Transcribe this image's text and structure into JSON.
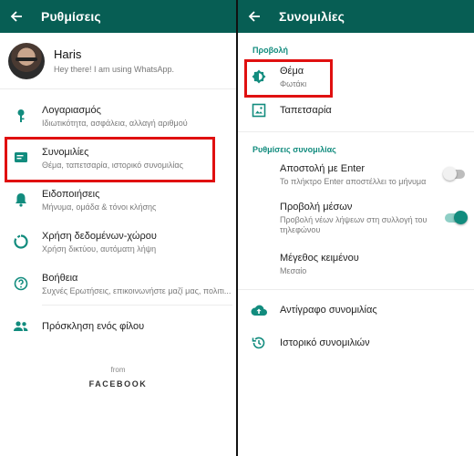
{
  "left": {
    "appbar": {
      "title": "Ρυθμίσεις"
    },
    "profile": {
      "name": "Haris",
      "status": "Hey there! I am using WhatsApp."
    },
    "items": [
      {
        "icon": "key-icon",
        "label": "Λογαριασμός",
        "sub": "Ιδιωτικότητα, ασφάλεια, αλλαγή αριθμού"
      },
      {
        "icon": "chat-icon",
        "label": "Συνομιλίες",
        "sub": "Θέμα, ταπετσαρία, ιστορικό συνομιλίας"
      },
      {
        "icon": "bell-icon",
        "label": "Ειδοποιήσεις",
        "sub": "Μήνυμα, ομάδα & τόνοι κλήσης"
      },
      {
        "icon": "data-usage-icon",
        "label": "Χρήση δεδομένων-χώρου",
        "sub": "Χρήση δικτύου, αυτόματη λήψη"
      },
      {
        "icon": "help-icon",
        "label": "Βοήθεια",
        "sub": "Συχνές Ερωτήσεις, επικοινωνήστε μαζί μας, πολιτι..."
      }
    ],
    "invite": {
      "icon": "people-icon",
      "label": "Πρόσκληση ενός φίλου"
    },
    "footer": {
      "from": "from",
      "brand": "FACEBOOK"
    }
  },
  "right": {
    "appbar": {
      "title": "Συνομιλίες"
    },
    "display_section": {
      "title": "Προβολή",
      "items": [
        {
          "icon": "theme-icon",
          "label": "Θέμα",
          "sub": "Φωτάκι"
        },
        {
          "icon": "wallpaper-icon",
          "label": "Ταπετσαρία",
          "sub": ""
        }
      ]
    },
    "chat_settings_section": {
      "title": "Ρυθμίσεις συνομιλίας",
      "items": [
        {
          "label": "Αποστολή με Enter",
          "sub": "Το πλήκτρο Enter αποστέλλει το μήνυμα",
          "toggle": "off"
        },
        {
          "label": "Προβολή μέσων",
          "sub": "Προβολή νέων λήψεων στη συλλογή του",
          "sub2": "τηλεφώνου",
          "toggle": "on"
        },
        {
          "label": "Μέγεθος κειμένου",
          "sub": "Μεσαίο"
        }
      ]
    },
    "bottom_items": [
      {
        "icon": "cloud-upload-icon",
        "label": "Αντίγραφο συνομιλίας"
      },
      {
        "icon": "history-icon",
        "label": "Ιστορικό συνομιλιών"
      }
    ]
  },
  "colors": {
    "appbar": "#075e54",
    "accent": "#128c7e",
    "highlight": "#e01010"
  }
}
